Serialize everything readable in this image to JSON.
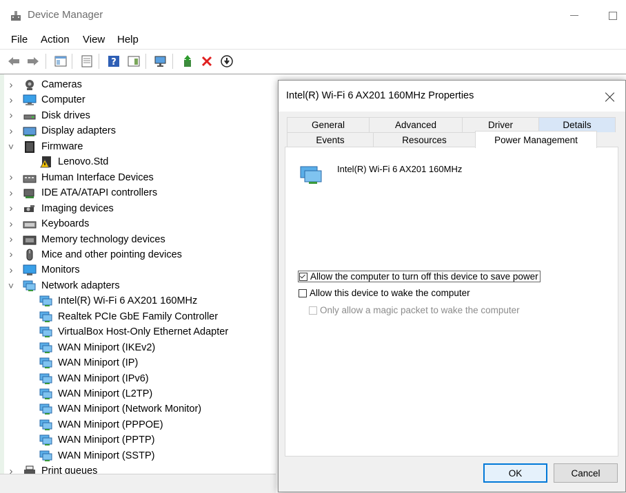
{
  "window": {
    "title": "Device Manager"
  },
  "menu": [
    "File",
    "Action",
    "View",
    "Help"
  ],
  "tree": [
    {
      "label": "Cameras",
      "icon": "camera-icon",
      "expanded": false,
      "level": 0
    },
    {
      "label": "Computer",
      "icon": "computer-icon",
      "expanded": false,
      "level": 0
    },
    {
      "label": "Disk drives",
      "icon": "disk-drive-icon",
      "expanded": false,
      "level": 0
    },
    {
      "label": "Display adapters",
      "icon": "display-adapter-icon",
      "expanded": false,
      "level": 0
    },
    {
      "label": "Firmware",
      "icon": "firmware-icon",
      "expanded": true,
      "level": 0
    },
    {
      "label": "Lenovo.Std",
      "icon": "warning-firmware-icon",
      "level": 1
    },
    {
      "label": "Human Interface Devices",
      "icon": "hid-icon",
      "expanded": false,
      "level": 0
    },
    {
      "label": "IDE ATA/ATAPI controllers",
      "icon": "ide-controller-icon",
      "expanded": false,
      "level": 0
    },
    {
      "label": "Imaging devices",
      "icon": "imaging-icon",
      "expanded": false,
      "level": 0
    },
    {
      "label": "Keyboards",
      "icon": "keyboard-icon",
      "expanded": false,
      "level": 0
    },
    {
      "label": "Memory technology devices",
      "icon": "memory-icon",
      "expanded": false,
      "level": 0
    },
    {
      "label": "Mice and other pointing devices",
      "icon": "mouse-icon",
      "expanded": false,
      "level": 0
    },
    {
      "label": "Monitors",
      "icon": "monitor-icon",
      "expanded": false,
      "level": 0
    },
    {
      "label": "Network adapters",
      "icon": "network-adapter-icon",
      "expanded": true,
      "level": 0
    },
    {
      "label": "Intel(R) Wi-Fi 6 AX201 160MHz",
      "icon": "network-adapter-icon",
      "level": 1
    },
    {
      "label": "Realtek PCIe GbE Family Controller",
      "icon": "network-adapter-icon",
      "level": 1
    },
    {
      "label": "VirtualBox Host-Only Ethernet Adapter",
      "icon": "network-adapter-icon",
      "level": 1
    },
    {
      "label": "WAN Miniport (IKEv2)",
      "icon": "network-adapter-icon",
      "level": 1
    },
    {
      "label": "WAN Miniport (IP)",
      "icon": "network-adapter-icon",
      "level": 1
    },
    {
      "label": "WAN Miniport (IPv6)",
      "icon": "network-adapter-icon",
      "level": 1
    },
    {
      "label": "WAN Miniport (L2TP)",
      "icon": "network-adapter-icon",
      "level": 1
    },
    {
      "label": "WAN Miniport (Network Monitor)",
      "icon": "network-adapter-icon",
      "level": 1
    },
    {
      "label": "WAN Miniport (PPPOE)",
      "icon": "network-adapter-icon",
      "level": 1
    },
    {
      "label": "WAN Miniport (PPTP)",
      "icon": "network-adapter-icon",
      "level": 1
    },
    {
      "label": "WAN Miniport (SSTP)",
      "icon": "network-adapter-icon",
      "level": 1
    },
    {
      "label": "Print queues",
      "icon": "printer-icon",
      "expanded": false,
      "level": 0
    }
  ],
  "dialog": {
    "title": "Intel(R) Wi-Fi 6 AX201 160MHz Properties",
    "tabs_row1": [
      "General",
      "Advanced",
      "Driver",
      "Details"
    ],
    "tabs_row2": [
      "Events",
      "Resources",
      "Power Management"
    ],
    "selected_tab": "Power Management",
    "device_name": "Intel(R) Wi-Fi 6 AX201 160MHz",
    "options": [
      {
        "label": "Allow the computer to turn off this device to save power",
        "checked": true,
        "enabled": true
      },
      {
        "label": "Allow this device to wake the computer",
        "checked": false,
        "enabled": true
      },
      {
        "label": "Only allow a magic packet to wake the computer",
        "checked": false,
        "enabled": false
      }
    ],
    "ok_label": "OK",
    "cancel_label": "Cancel"
  },
  "colors": {
    "accent": "#0078d7",
    "tab_highlight": "#d8e6f7",
    "disabled_text": "#8c8c8c"
  }
}
